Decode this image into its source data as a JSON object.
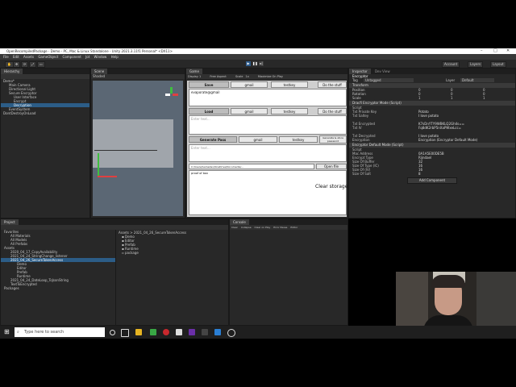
{
  "window": {
    "title": "OpenRecompiledPackage - Demo - PC, Mac & Linux Standalone - Unity 2021.3.11f1 Personal* <DX11>"
  },
  "menu": [
    "File",
    "Edit",
    "Assets",
    "GameObject",
    "Component",
    "Jot",
    "Window",
    "Help"
  ],
  "toolbar": {
    "account": "Account",
    "layers": "Layers",
    "layout": "Layout"
  },
  "hierarchy": {
    "tab": "Hierarchy",
    "items": [
      "Demo*",
      "Main Camera",
      "Directional Light",
      "Secure Encryptor",
      "User Interface",
      "Encrypt",
      "Decryption",
      "EventSystem",
      "DontDestroyOnLoad"
    ]
  },
  "scene": {
    "tab": "Scene",
    "mode": "Shaded"
  },
  "game": {
    "tab": "Game",
    "display": "Display 1",
    "resolution": "Free Aspect",
    "scale_label": "Scale",
    "scale": "1x",
    "play_mode": "Maximize On Play",
    "save_button": "Save",
    "gmail_button": "gmail",
    "testkey_button": "testkey",
    "dostuff_button": "Do the stuff",
    "email_text": "evaporate@gmail",
    "load_button": "Load",
    "enter_text": "Enter text...",
    "generate_pass": "Generate Pass",
    "generate_store": "Generate & store password",
    "file_path": "C:/Users/Gamedev/OneDrive/Documents/...",
    "open_file": "Open file",
    "output_text": "proof of box",
    "clear_storage": "Clear storage"
  },
  "inspector": {
    "tabs": [
      "Inspector",
      "Dev View"
    ],
    "object_name": "Encryptor",
    "tag_label": "Tag",
    "tag": "Untagged",
    "layer_label": "Layer",
    "layer": "Default",
    "transform": {
      "title": "Transform",
      "rows": [
        {
          "label": "Position",
          "x": "0",
          "y": "0",
          "z": "0"
        },
        {
          "label": "Rotation",
          "x": "0",
          "y": "0",
          "z": "0"
        },
        {
          "label": "Scale",
          "x": "1",
          "y": "1",
          "z": "1"
        }
      ]
    },
    "comp1": {
      "title": "Dracfi Encryptor Mode (Script)",
      "rows": [
        {
          "k": "Script",
          "v": ""
        },
        {
          "k": "Txt Private Key",
          "v": "Potato"
        },
        {
          "k": "Txt Saltey",
          "v": "I love potato"
        },
        {
          "k": "",
          "v": ""
        },
        {
          "k": "Txt Encrypted",
          "v": "K7sDnYTY9WBKLQ2Gh4s=="
        },
        {
          "k": "Txt IV",
          "v": "Fq8dK2rbP5nXaPWxeLcc="
        },
        {
          "k": "",
          "v": ""
        },
        {
          "k": "Txt Decrypted",
          "v": "I love potato"
        },
        {
          "k": "Encryption",
          "v": "Encryption (Encryptor Default Mode)"
        }
      ]
    },
    "comp2": {
      "title": "Encryptor Default Mode (Script)",
      "rows": [
        {
          "k": "Script",
          "v": ""
        },
        {
          "k": "Mac Address",
          "v": "0A1A5E00DE5B"
        },
        {
          "k": "Encrypt Type",
          "v": "Rijndael"
        },
        {
          "k": "Size Of Buffer",
          "v": "32"
        },
        {
          "k": "Size Of Type (IC)",
          "v": "16"
        },
        {
          "k": "Size Of (IV)",
          "v": "16"
        },
        {
          "k": "Size Of Salt",
          "v": "8"
        }
      ]
    },
    "add_component": "Add Component"
  },
  "project": {
    "tabs": [
      "Project",
      "Console"
    ],
    "tree": [
      "Favorites",
      "All Materials",
      "All Models",
      "All Prefabs",
      "Assets",
      "2020_04_17_CopyAvailability",
      "2021_04_24_StringChange_listener",
      "2021_04_26_SecureTokenAccess",
      "Demo",
      "Editor",
      "Prefab",
      "Runtime",
      "2021_04_24_DateLoop_ToJsonString",
      "TextToEncrypted",
      "Packages"
    ],
    "breadcrumb": "Assets > 2021_04_26_SecureTokenAccess",
    "files": [
      "Demo",
      "Editor",
      "Prefab",
      "Runtime",
      "package"
    ]
  },
  "console": {
    "tab": "Console",
    "buttons": [
      "Clear",
      "Collapse",
      "Clear on Play",
      "Error Pause",
      "Editor"
    ]
  },
  "taskbar": {
    "search_placeholder": "Type here to search"
  }
}
